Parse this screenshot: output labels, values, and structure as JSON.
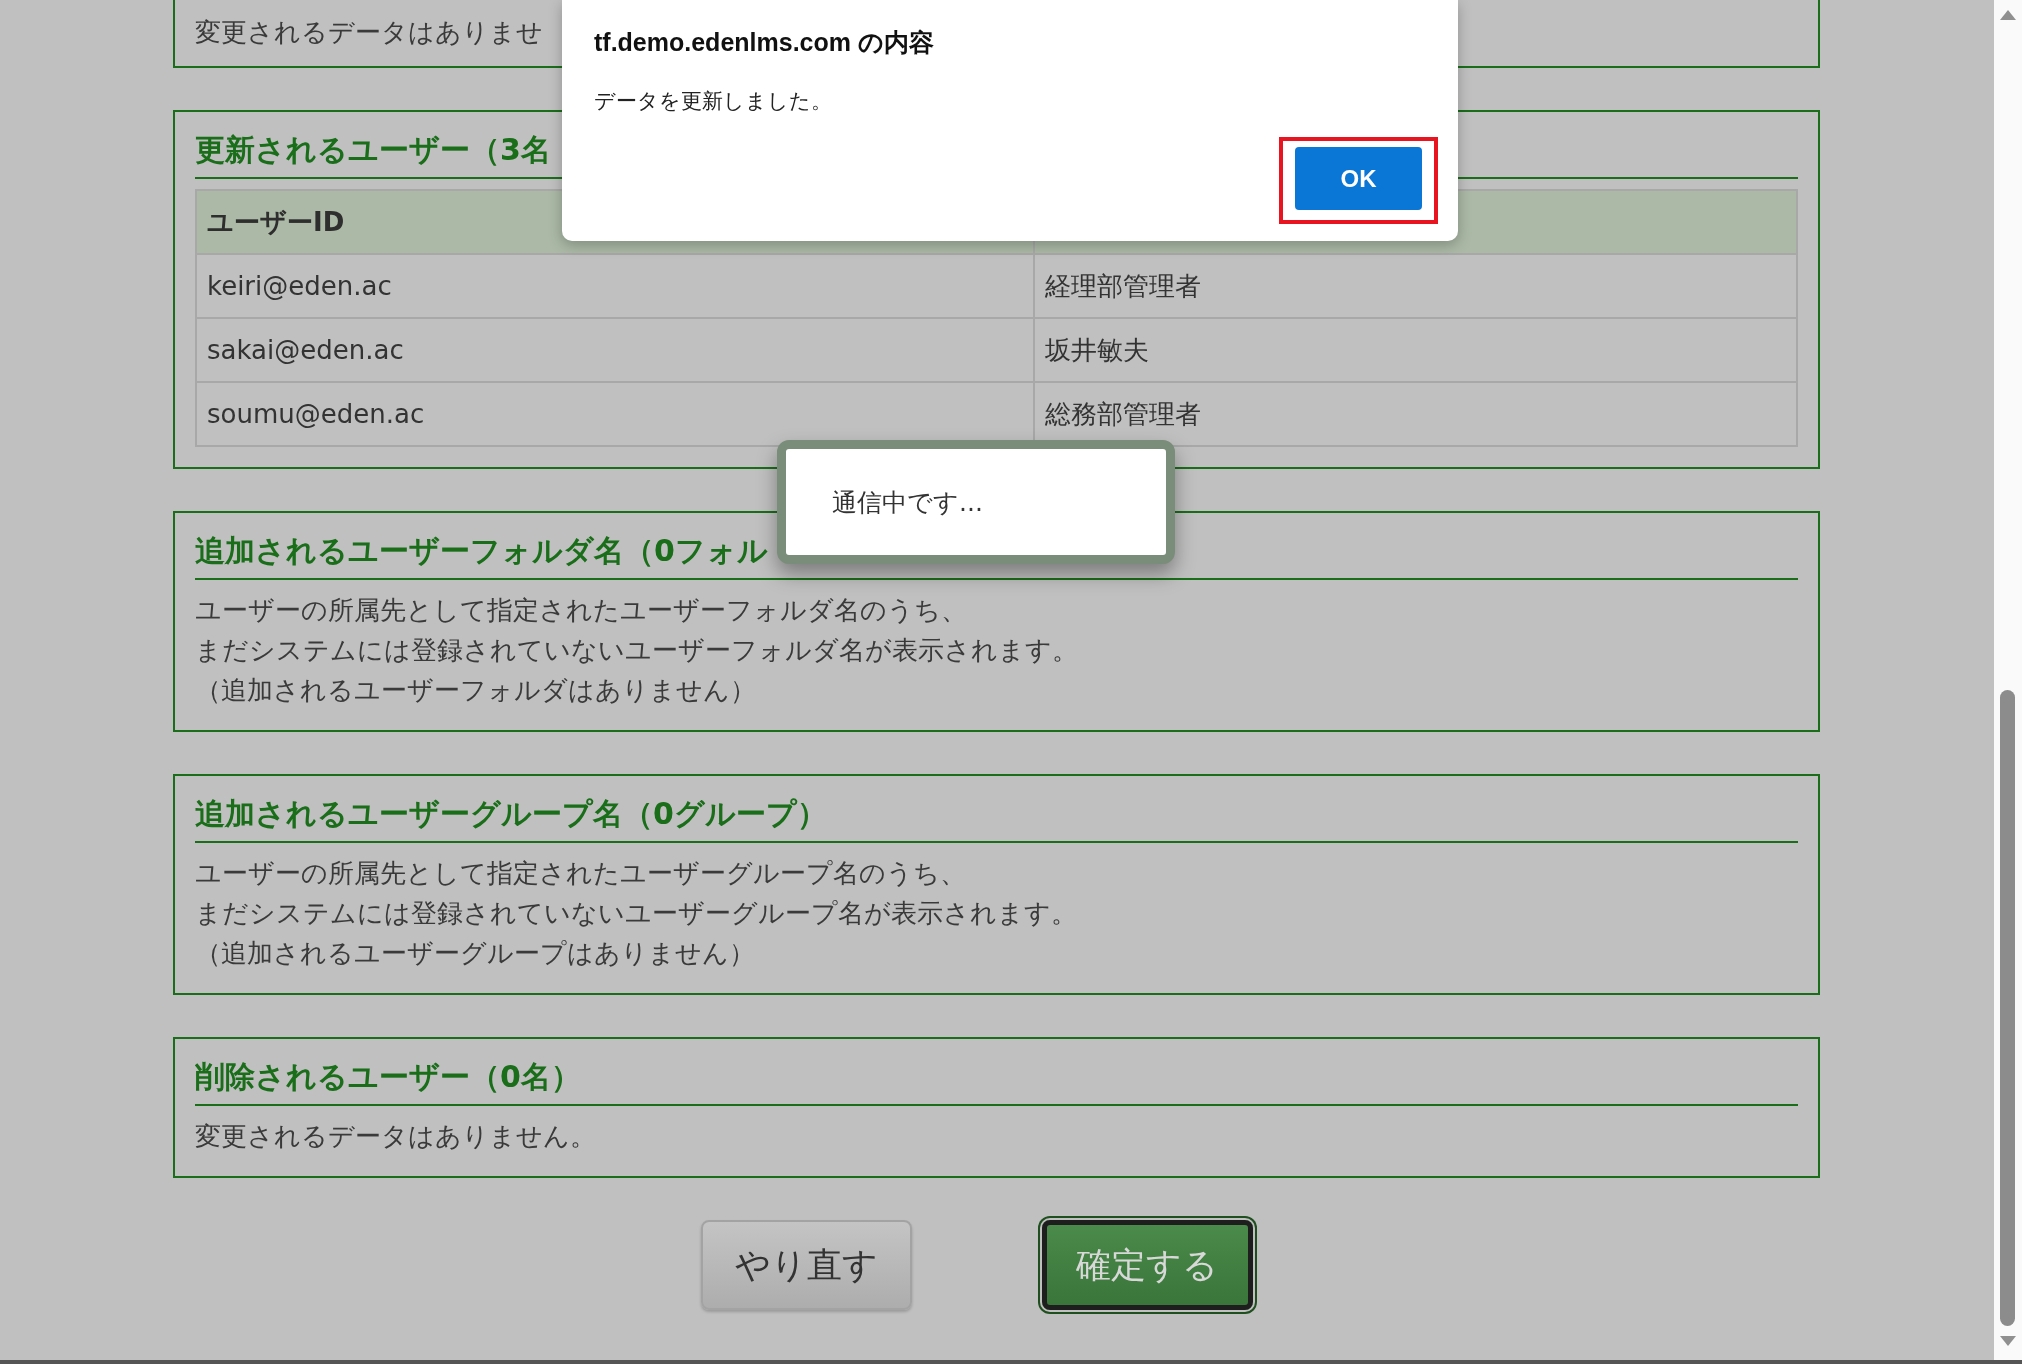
{
  "top_section": {
    "text": "変更されるデータはありませ"
  },
  "updated_users": {
    "title": "更新されるユーザー（3名",
    "columns": [
      "ユーザーID"
    ],
    "rows": [
      {
        "user_id": "keiri@eden.ac",
        "column_2": "経理部管理者"
      },
      {
        "user_id": "sakai@eden.ac",
        "column_2": "坂井敏夫"
      },
      {
        "user_id": "soumu@eden.ac",
        "column_2": "総務部管理者"
      }
    ]
  },
  "info_sections": [
    {
      "title": "追加されるユーザーフォルダ名（0フォル",
      "lines": [
        "ユーザーの所属先として指定されたユーザーフォルダ名のうち、",
        "まだシステムには登録されていないユーザーフォルダ名が表示されます。",
        "（追加されるユーザーフォルダはありません）"
      ]
    },
    {
      "title": "追加されるユーザーグループ名（0グループ）",
      "lines": [
        "ユーザーの所属先として指定されたユーザーグループ名のうち、",
        "まだシステムには登録されていないユーザーグループ名が表示されます。",
        "（追加されるユーザーグループはありません）"
      ]
    },
    {
      "title": "削除されるユーザー（0名）",
      "lines": [
        "変更されるデータはありません。"
      ]
    }
  ],
  "buttons": [
    {
      "label": "やり直す",
      "kind": "secondary"
    },
    {
      "label": "確定する",
      "kind": "primary"
    }
  ],
  "alert": {
    "title": "tf.demo.edenlms.com の内容",
    "message": "データを更新しました。",
    "ok_button": "OK",
    "ok_highlighted": true
  },
  "loading": {
    "message": "通信中です..."
  }
}
